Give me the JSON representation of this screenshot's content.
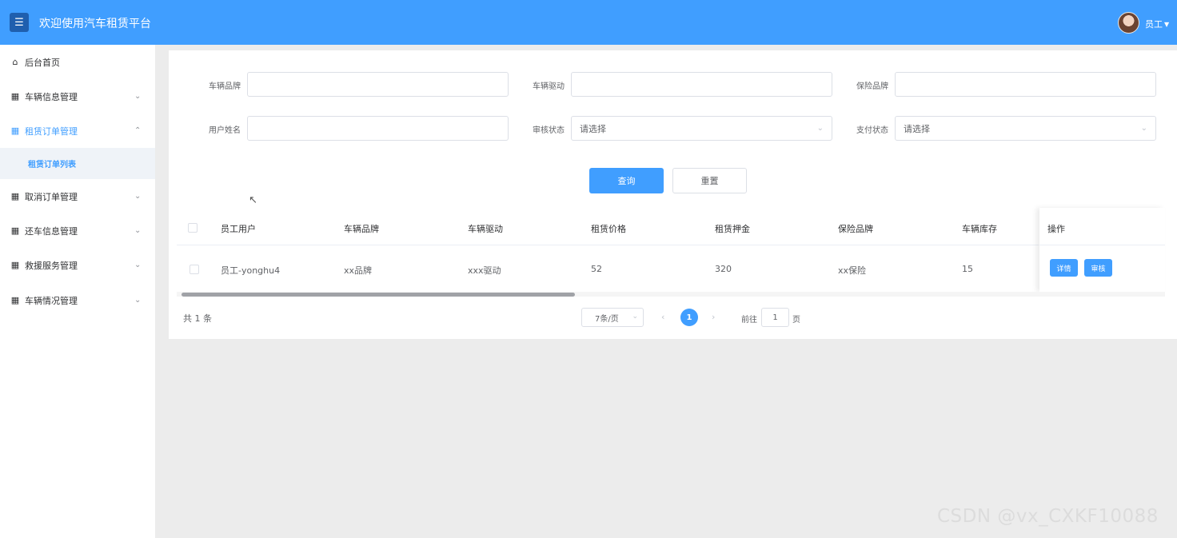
{
  "header": {
    "menu_icon": "hamburger-icon",
    "title": "欢迎使用汽车租赁平台",
    "user_label": "员工",
    "colors": {
      "primary": "#409eff",
      "menu_button": "#1f5fae"
    }
  },
  "sidebar": {
    "items": [
      {
        "label": "后台首页",
        "icon": "home-icon"
      },
      {
        "label": "车辆信息管理",
        "icon": "grid-icon"
      },
      {
        "label": "租赁订单管理",
        "icon": "grid-icon",
        "expanded": true
      },
      {
        "label": "取消订单管理",
        "icon": "grid-icon"
      },
      {
        "label": "还车信息管理",
        "icon": "grid-icon"
      },
      {
        "label": "救援服务管理",
        "icon": "grid-icon"
      },
      {
        "label": "车辆情况管理",
        "icon": "grid-icon"
      }
    ],
    "sub_item": "租赁订单列表"
  },
  "search": {
    "fields": [
      {
        "label": "车辆品牌",
        "value": ""
      },
      {
        "label": "车辆驱动",
        "value": ""
      },
      {
        "label": "保险品牌",
        "value": ""
      },
      {
        "label": "用户姓名",
        "value": ""
      },
      {
        "label": "审核状态",
        "placeholder": "请选择"
      },
      {
        "label": "支付状态",
        "placeholder": "请选择"
      }
    ],
    "query_button": "查询",
    "reset_button": "重置"
  },
  "table": {
    "headers": [
      "员工用户",
      "车辆品牌",
      "车辆驱动",
      "租赁价格",
      "租赁押金",
      "保险品牌",
      "车辆库存",
      "操作"
    ],
    "rows": [
      {
        "cells": [
          "员工-yonghu4",
          "xx品牌",
          "xxx驱动",
          "52",
          "320",
          "xx保险",
          "15"
        ],
        "detail_button": "详情",
        "audit_button": "审核"
      }
    ]
  },
  "pagination": {
    "total": "共 1 条",
    "page_size": "7条/页",
    "current_page": "1",
    "goto_label": "前往",
    "goto_value": "1",
    "page_suffix": "页"
  },
  "watermark": "CSDN @vx_CXKF10088"
}
